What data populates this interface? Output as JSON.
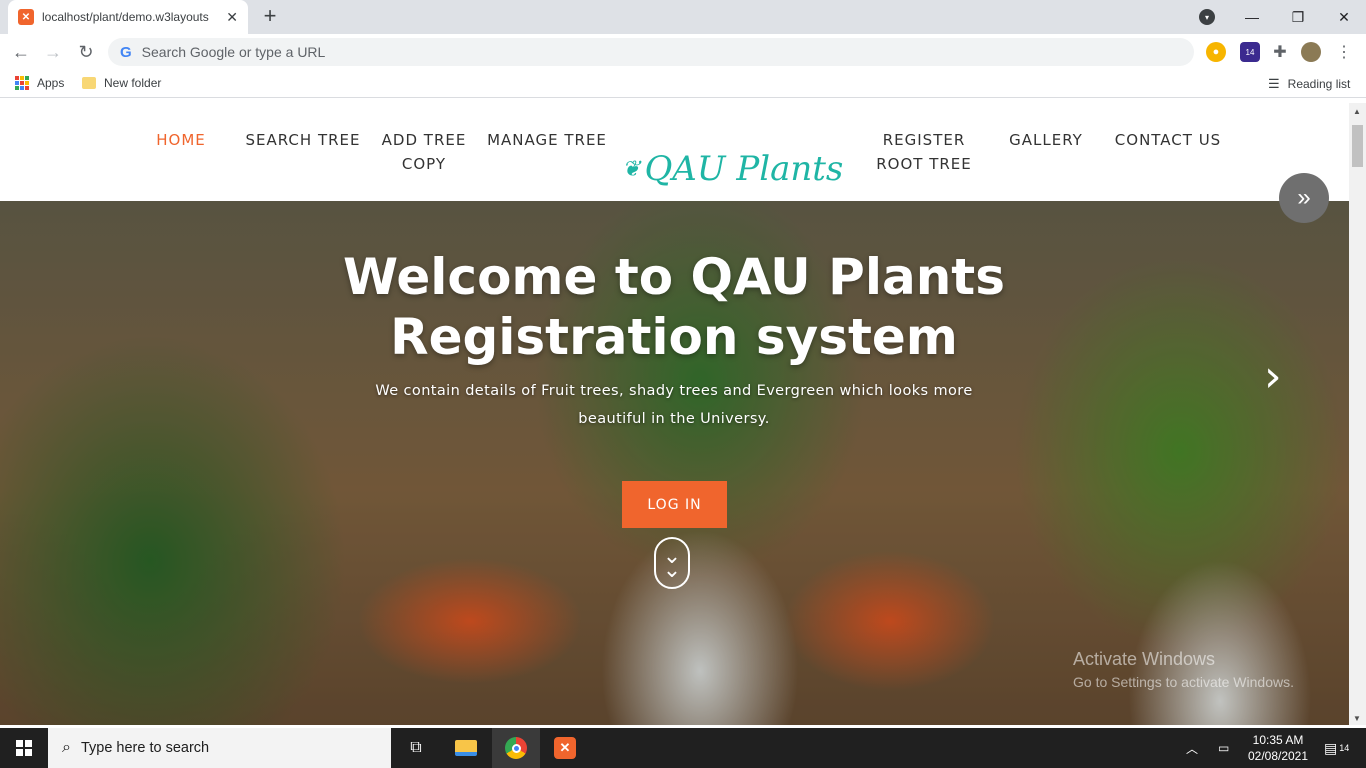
{
  "browser": {
    "tab_title": "localhost/plant/demo.w3layouts",
    "tab_close": "✕",
    "new_tab": "+",
    "omnibox_placeholder": "Search Google or type a URL",
    "bookmarks": {
      "apps": "Apps",
      "new_folder": "New folder",
      "reading_list": "Reading list"
    },
    "notification_count": "14"
  },
  "site": {
    "nav": {
      "home": "HOME",
      "search_tree": "SEARCH TREE",
      "add_tree_1": "ADD TREE",
      "add_tree_2": "COPY",
      "manage_tree": "MANAGE TREE",
      "register_1": "REGISTER",
      "register_2": "ROOT TREE",
      "gallery": "GALLERY",
      "contact": "CONTACT US"
    },
    "logo": "QAU Plants",
    "hero": {
      "title": "Welcome to QAU Plants Registration system",
      "subtitle": "We contain details of Fruit trees, shady trees and Evergreen which looks more beautiful in the Universy.",
      "login": "LOG IN"
    },
    "watermark": {
      "line1": "Activate Windows",
      "line2": "Go to Settings to activate Windows."
    }
  },
  "taskbar": {
    "search_placeholder": "Type here to search",
    "time": "10:35 AM",
    "date": "02/08/2021",
    "notifications": "14"
  },
  "colors": {
    "accent": "#f0652d",
    "logo": "#1fb5a5",
    "taskbar": "#202020"
  }
}
